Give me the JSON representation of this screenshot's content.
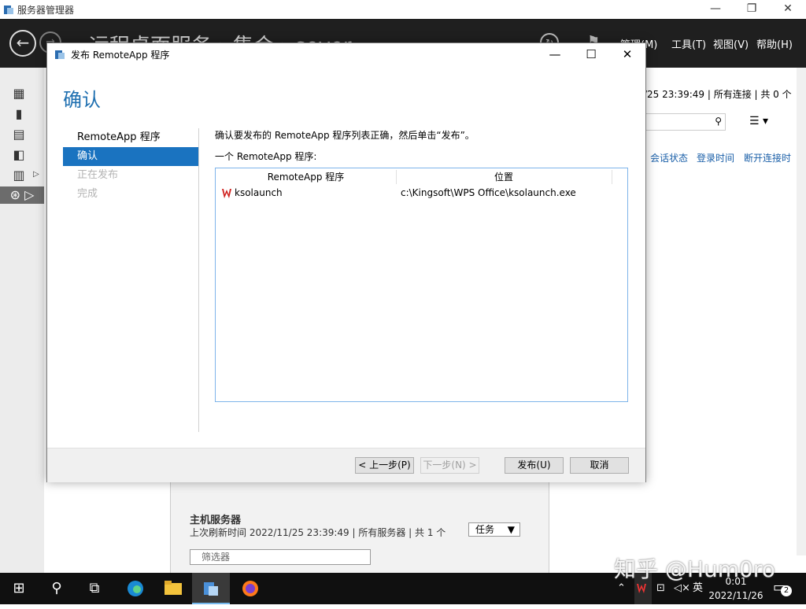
{
  "window": {
    "title": "服务器管理器",
    "minimize": "—",
    "restore": "❐",
    "close": "✕"
  },
  "header": {
    "breadcrumb": "· · 远程桌面服务 › 集合 › sever",
    "menus": [
      "管理(M)",
      "工具(T)",
      "视图(V)",
      "帮助(H)"
    ]
  },
  "background": {
    "refresh_text": "/25 23:39:49 | 所有连接 | 共 0 个",
    "columns": [
      "会话状态",
      "登录时间",
      "断开连接时"
    ],
    "host_section_title": "主机服务器",
    "host_section_sub": "上次刷新时间 2022/11/25 23:39:49 | 所有服务器 | 共 1 个",
    "tasks_label": "任务",
    "filter_placeholder": "筛选器"
  },
  "dialog": {
    "title": "发布 RemoteApp 程序",
    "heading": "确认",
    "steps": [
      {
        "label": "RemoteApp 程序",
        "state": "normal"
      },
      {
        "label": "确认",
        "state": "active"
      },
      {
        "label": "正在发布",
        "state": "disabled"
      },
      {
        "label": "完成",
        "state": "disabled"
      }
    ],
    "instruction": "确认要发布的 RemoteApp 程序列表正确，然后单击“发布”。",
    "list_label": "一个 RemoteApp 程序:",
    "columns": [
      "RemoteApp 程序",
      "位置"
    ],
    "rows": [
      {
        "name": "ksolaunch",
        "location": "c:\\Kingsoft\\WPS Office\\ksolaunch.exe"
      }
    ],
    "buttons": {
      "prev": "< 上一步(P)",
      "next": "下一步(N) >",
      "publish": "发布(U)",
      "cancel": "取消"
    }
  },
  "taskbar": {
    "time": "0:01",
    "date": "2022/11/26",
    "ime": "英",
    "notifications": "2"
  },
  "watermark": "知乎 @Hum0ro"
}
